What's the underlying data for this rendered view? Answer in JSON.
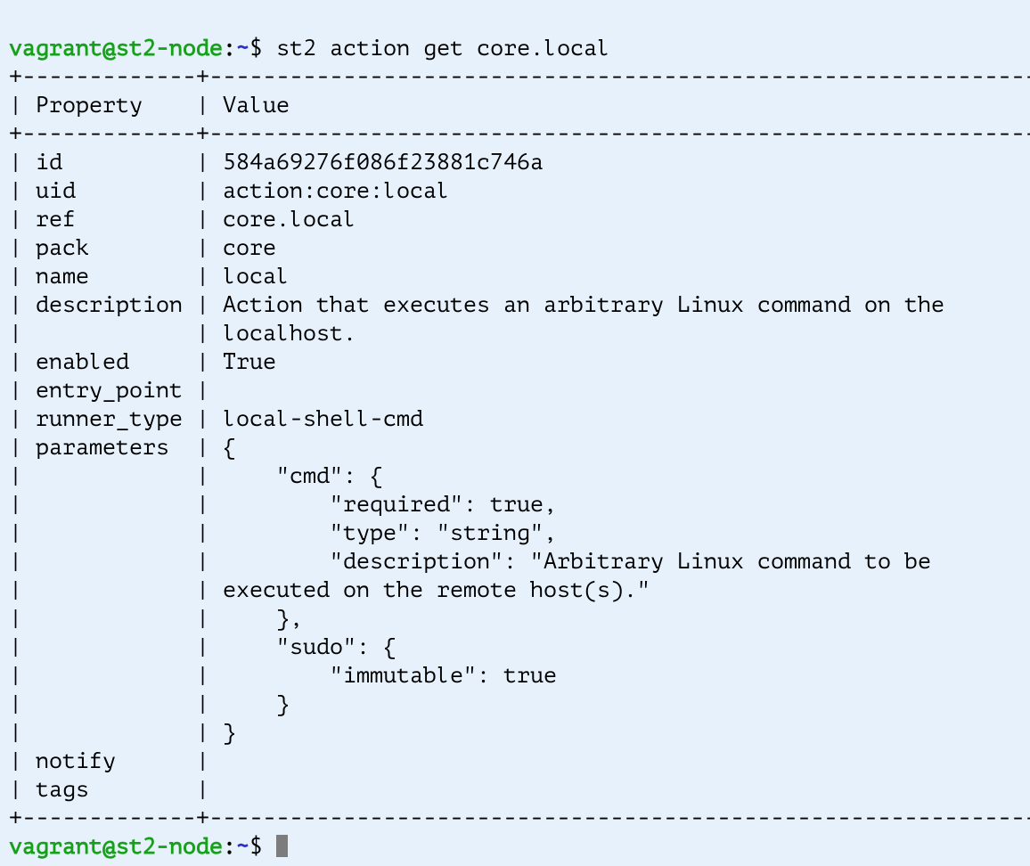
{
  "prompt": {
    "user_host": "vagrant@st2-node",
    "colon": ":",
    "tilde": "~",
    "dollar": "$"
  },
  "command": "st2 action get core.local",
  "borders": {
    "top": "+-------------+--------------------------------------------------------------+",
    "mid": "+-------------+--------------------------------------------------------------+",
    "bottom": "+-------------+--------------------------------------------------------------+"
  },
  "header": {
    "line": "| Property    | Value                                                        |"
  },
  "rows": [
    "| id          | 584a69276f086f23881c746a                                     |",
    "| uid         | action:core:local                                            |",
    "| ref         | core.local                                                   |",
    "| pack        | core                                                         |",
    "| name        | local                                                        |",
    "| description | Action that executes an arbitrary Linux command on the       |",
    "|             | localhost.                                                   |",
    "| enabled     | True                                                         |",
    "| entry_point |                                                              |",
    "| runner_type | local-shell-cmd                                              |",
    "| parameters  | {                                                            |",
    "|             |     \"cmd\": {                                                 |",
    "|             |         \"required\": true,                                    |",
    "|             |         \"type\": \"string\",                                    |",
    "|             |         \"description\": \"Arbitrary Linux command to be        |",
    "|             | executed on the remote host(s).\"                             |",
    "|             |     },                                                       |",
    "|             |     \"sudo\": {                                                |",
    "|             |         \"immutable\": true                                    |",
    "|             |     }                                                        |",
    "|             | }                                                            |",
    "| notify      |                                                              |",
    "| tags        |                                                              |"
  ]
}
